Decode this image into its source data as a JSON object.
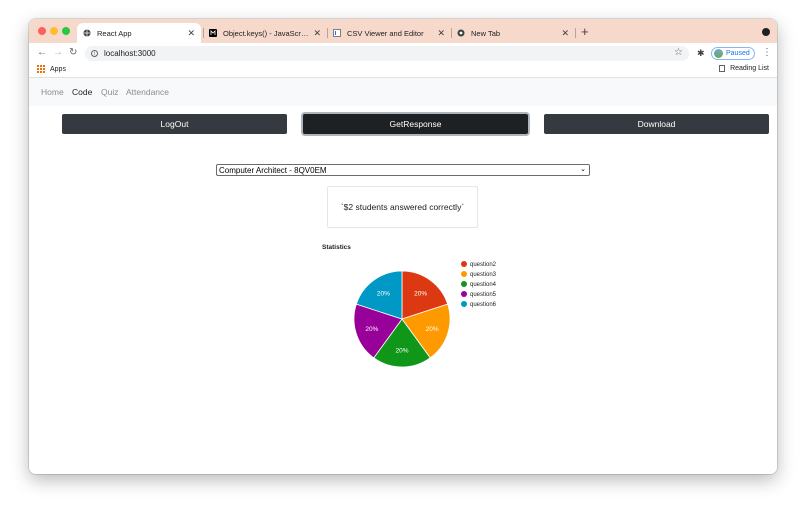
{
  "browser": {
    "tabs": [
      {
        "title": "React App",
        "active": true
      },
      {
        "title": "Object.keys() - JavaScript | MD",
        "active": false
      },
      {
        "title": "CSV Viewer and Editor",
        "active": false
      },
      {
        "title": "New Tab",
        "active": false
      }
    ],
    "url": "localhost:3000",
    "profile_status": "Paused",
    "bookmarks": {
      "apps_label": "Apps",
      "reading_list_label": "Reading List"
    }
  },
  "navbar": {
    "links": [
      "Home",
      "Code",
      "Quiz",
      "Attendance"
    ],
    "active": "Code"
  },
  "buttons": {
    "logout": "LogOut",
    "get_response": "GetResponse",
    "download": "Download"
  },
  "select": {
    "value": "Computer Architect - 8QV0EM"
  },
  "answer_text": "`$2 students answered correctly`",
  "colors": {
    "button_dark": "#343a40",
    "slice_red": "#dc3912",
    "slice_orange": "#ff9900",
    "slice_green": "#109618",
    "slice_purple": "#990099",
    "slice_cyan": "#0099c6"
  },
  "chart_data": {
    "type": "pie",
    "title": "Statistics",
    "labels": [
      "question2",
      "question3",
      "question4",
      "question5",
      "question6"
    ],
    "values": [
      20,
      20,
      20,
      20,
      20
    ],
    "slice_labels": [
      "20%",
      "20%",
      "20%",
      "20%",
      "20%"
    ],
    "colors": [
      "#dc3912",
      "#ff9900",
      "#109618",
      "#990099",
      "#0099c6"
    ],
    "legend_position": "right"
  }
}
